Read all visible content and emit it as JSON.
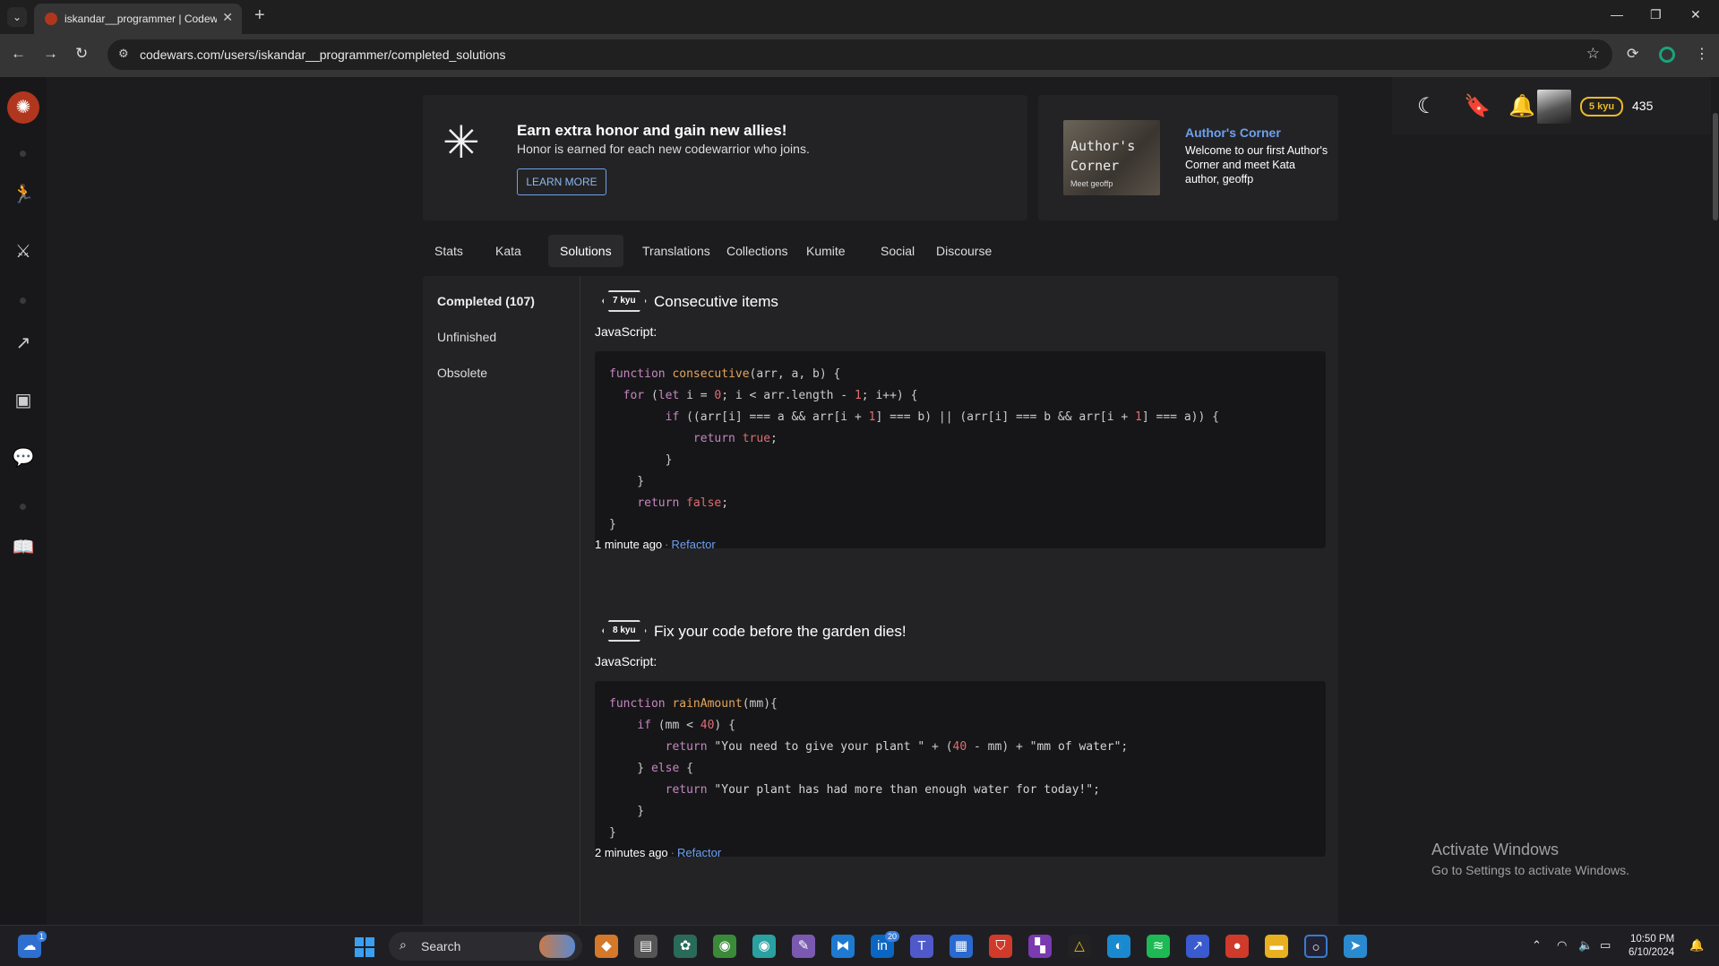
{
  "browser": {
    "tab_title": "iskandar__programmer | Codewars",
    "url": "codewars.com/users/iskandar__programmer/completed_solutions"
  },
  "banner": {
    "title": "Earn extra honor and gain new allies!",
    "text": "Honor is earned for each new codewarrior who joins.",
    "button": "LEARN MORE"
  },
  "author_corner": {
    "image_line1": "Author's",
    "image_line2": "Corner",
    "image_line3": "Meet geoffp",
    "title": "Author's Corner",
    "text": "Welcome to our first Author's Corner and meet Kata author, geoffp"
  },
  "user": {
    "rank": "5 kyu",
    "honor": "435"
  },
  "profile_tabs": [
    "Stats",
    "Kata",
    "Solutions",
    "Translations",
    "Collections",
    "Kumite",
    "Social",
    "Discourse"
  ],
  "active_tab": "Solutions",
  "solution_nav": {
    "completed": "Completed (107)",
    "unfinished": "Unfinished",
    "obsolete": "Obsolete"
  },
  "solutions": [
    {
      "kyu": "7 kyu",
      "title": "Consecutive items",
      "language": "JavaScript:",
      "time": "1 minute ago",
      "refactor": "Refactor"
    },
    {
      "kyu": "8 kyu",
      "title": "Fix your code before the garden dies!",
      "language": "JavaScript:",
      "time": "2 minutes ago",
      "refactor": "Refactor"
    }
  ],
  "watermark": {
    "line1": "Activate Windows",
    "line2": "Go to Settings to activate Windows."
  },
  "taskbar": {
    "search": "Search",
    "time": "10:50 PM",
    "date": "6/10/2024"
  }
}
